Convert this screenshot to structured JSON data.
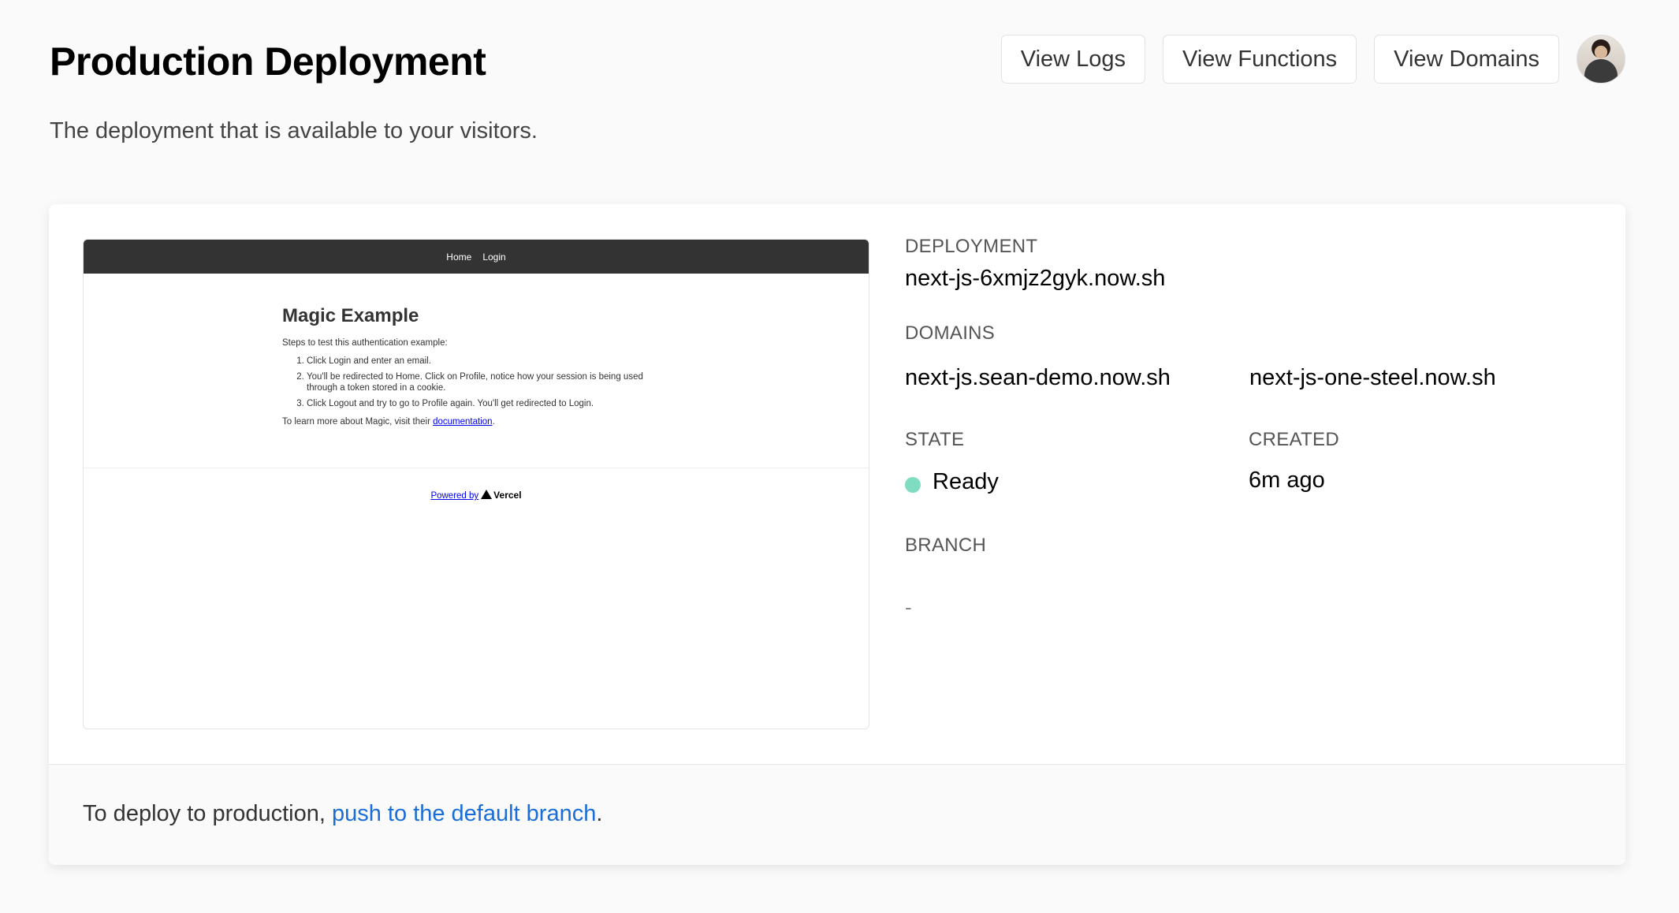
{
  "header": {
    "title": "Production Deployment",
    "subtitle": "The deployment that is available to your visitors.",
    "buttons": {
      "view_logs": "View Logs",
      "view_functions": "View Functions",
      "view_domains": "View Domains"
    },
    "avatar_icon": "user-avatar"
  },
  "preview": {
    "nav": [
      "Home",
      "Login"
    ],
    "title": "Magic Example",
    "intro": "Steps to test this authentication example:",
    "steps": [
      "Click Login and enter an email.",
      "You'll be redirected to Home. Click on Profile, notice how your session is being used through a token stored in a cookie.",
      "Click Logout and try to go to Profile again. You'll get redirected to Login."
    ],
    "learn_prefix": "To learn more about Magic, visit their ",
    "learn_link": "documentation",
    "learn_suffix": ".",
    "powered_by": "Powered by",
    "vercel": "Vercel"
  },
  "details": {
    "deployment_label": "DEPLOYMENT",
    "deployment_url": "next-js-6xmjz2gyk.now.sh",
    "domains_label": "DOMAINS",
    "domains": [
      "next-js.sean-demo.now.sh",
      "next-js-one-steel.now.sh"
    ],
    "state_label": "STATE",
    "state_value": "Ready",
    "state_color": "#7fdcc0",
    "created_label": "CREATED",
    "created_value": "6m ago",
    "branch_label": "BRANCH",
    "branch_value": "-"
  },
  "footer": {
    "text_prefix": "To deploy to production, ",
    "link_text": "push to the default branch",
    "text_suffix": ".",
    "link_color": "#1a6dd8"
  }
}
